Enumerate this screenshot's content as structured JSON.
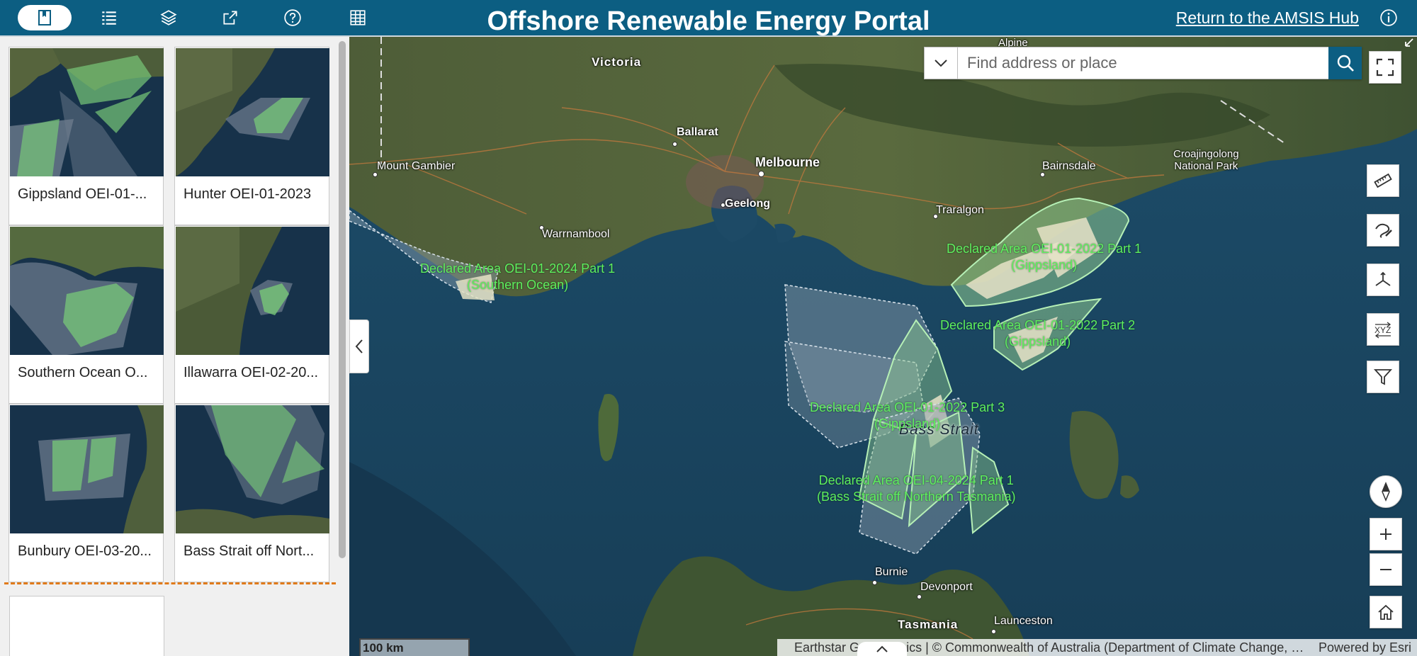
{
  "header": {
    "title": "Offshore Renewable Energy Portal",
    "hub_link": "Return to the AMSIS Hub",
    "toolbar_icons": [
      "bookmark-icon",
      "list-icon",
      "layers-icon",
      "share-icon",
      "help-icon",
      "table-icon",
      "info-icon"
    ]
  },
  "bookmarks": [
    {
      "label": "Gippsland OEI-01-..."
    },
    {
      "label": "Hunter OEI-01-2023"
    },
    {
      "label": "Southern Ocean O..."
    },
    {
      "label": "Illawarra OEI-02-20..."
    },
    {
      "label": "Bunbury OEI-03-20..."
    },
    {
      "label": "Bass Strait off Nort..."
    }
  ],
  "search": {
    "placeholder": "Find address or place"
  },
  "map": {
    "places": {
      "victoria": "Victoria",
      "alpine": "Alpine",
      "ballarat": "Ballarat",
      "melbourne": "Melbourne",
      "geelong": "Geelong",
      "mount_gambier": "Mount Gambier",
      "warrnambool": "Warrnambool",
      "bairnsdale": "Bairnsdale",
      "traralgon": "Traralgon",
      "croajingolong": "Croajingolong\nNational Park",
      "burnie": "Burnie",
      "devonport": "Devonport",
      "launceston": "Launceston",
      "tasmania": "Tasmania",
      "bass_strait": "Bass Strait"
    },
    "areas": [
      {
        "line1": "Declared Area OEI-01-2024 Part 1",
        "line2": "(Southern Ocean)"
      },
      {
        "line1": "Declared Area OEI-01-2022 Part 1",
        "line2": "(Gippsland)"
      },
      {
        "line1": "Declared Area OEI-01-2022 Part 2",
        "line2": "(Gippsland)"
      },
      {
        "line1": "Declared Area OEI-01-2022 Part 3",
        "line2": "(Gippsland)"
      },
      {
        "line1": "Declared Area OEI-04-2024 Part 1",
        "line2": "(Bass Strait off Northern Tasmania)"
      }
    ],
    "scale": "100 km",
    "attribution": "Earthstar Geographics | © Commonwealth of Australia (Department of Climate Change, Energy, the Environment and Water)",
    "powered_by": "Powered by Esri"
  },
  "colors": {
    "header": "#0c5e82",
    "area_label": "#5ef05e",
    "divider": "#e07a1a"
  }
}
